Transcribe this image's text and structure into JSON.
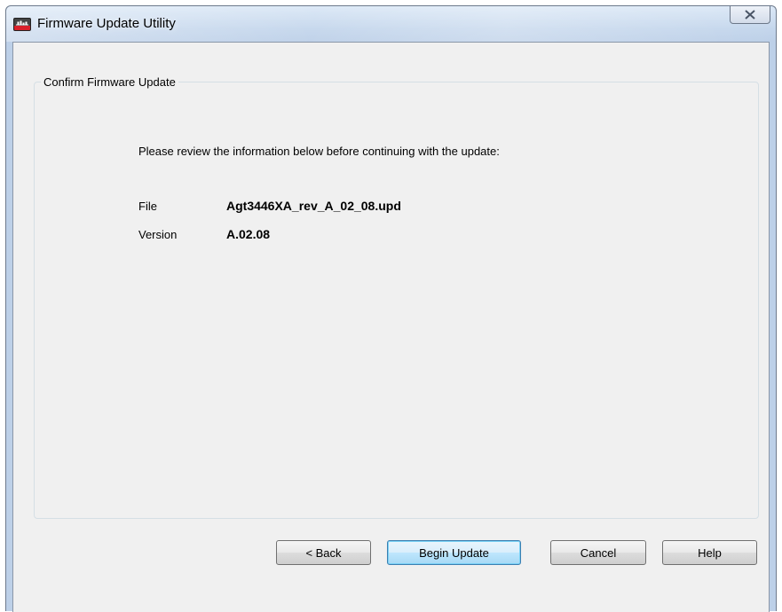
{
  "window": {
    "title": "Firmware Update Utility",
    "close_label": "X",
    "icon": "app-logo-icon"
  },
  "group": {
    "legend": "Confirm Firmware Update"
  },
  "content": {
    "intro": "Please review the information below before continuing with the update:",
    "rows": [
      {
        "label": "File",
        "value": "Agt3446XA_rev_A_02_08.upd"
      },
      {
        "label": "Version",
        "value": "A.02.08"
      }
    ]
  },
  "buttons": {
    "back": "< Back",
    "begin": "Begin Update",
    "cancel": "Cancel",
    "help": "Help"
  },
  "colors": {
    "dialog_bg": "#f0f0f0",
    "default_button_border": "#3c7fb1"
  }
}
